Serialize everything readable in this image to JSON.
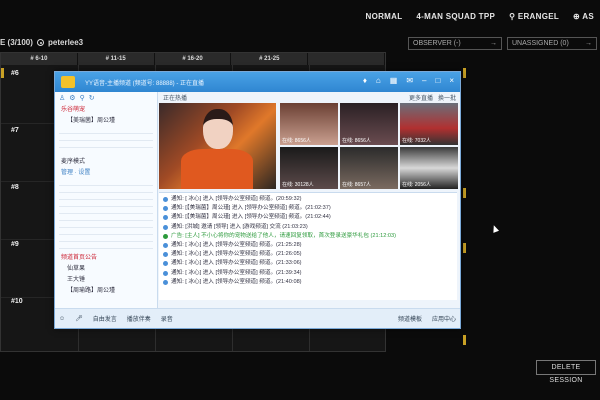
{
  "topnav": {
    "mode": "NORMAL",
    "squad": "4-MAN SQUAD TPP",
    "map": "ERANGEL",
    "region": "AS"
  },
  "session": {
    "count": "E (3/100)",
    "user": "peterlee3"
  },
  "dropdowns": {
    "observer": "OBSERVER (-)",
    "unassigned": "UNASSIGNED (0)"
  },
  "grid": {
    "columns": [
      "# 6-10",
      "# 11-15",
      "# 16-20",
      "# 21-25",
      ""
    ],
    "rows": [
      "#6",
      "#7",
      "#8",
      "#9",
      "#10"
    ]
  },
  "delete_label": "DELETE SESSION",
  "chat": {
    "title": "YY语音-主播频道 (频道号: 88888) - 正在直播",
    "live_label": "正在热播",
    "more_label": "更多直播",
    "switch_label": "换一批",
    "sidebar": {
      "group1": "乐谷萌宠",
      "group2": "【美瑞菌】周公瑾",
      "mode": "麦序模式",
      "links": "管理 · 设置",
      "group3": "频道首页公告",
      "member1": "仙草果",
      "member2": "王大锤",
      "member3": "【周瑜路】周公瑾"
    },
    "thumbs": [
      "在线: 8656人",
      "在线: 8656人",
      "在线: 7032人",
      "在线: 30128人",
      "在线: 8657人",
      "在线: 2056人"
    ],
    "log": [
      "通知: [ 冰心] 进入 [领导办公室频道] 频道。(20:59:32)",
      "通知: [【美瑞菌】周公瑾] 进入 [领导办公室频道] 频道。(21:02:37)",
      "通知: [【美瑞菌】周公瑾] 进入 [领导办公室频道] 频道。(21:02:44)",
      "通知: [洪城] 邀请 [领导] 进入 [游戏频道] 交流 (21:03:23)",
      "广告: [主人] 不小心将你的宠物送给了他人，请速回复领取，首次登录送豪华礼包 (21:12:03)",
      "通知: [ 冰心] 进入 [领导办公室频道] 频道。(21:25:28)",
      "通知: [ 冰心] 进入 [领导办公室频道] 频道。(21:26:05)",
      "通知: [ 冰心] 进入 [领导办公室频道] 频道。(21:33:06)",
      "通知: [ 冰心] 进入 [领导办公室频道] 频道。(21:39:34)",
      "通知: [ 冰心] 进入 [领导办公室频道] 频道。(21:40:08)"
    ],
    "footer": {
      "free_speak": "自由发言",
      "broadcast": "播放伴奏",
      "record": "录音",
      "channel_tmpl": "频道模板",
      "app_center": "应用中心"
    }
  },
  "colors": {
    "accent_yellow": "#c9a125",
    "chat_blue": "#2f86d1"
  }
}
